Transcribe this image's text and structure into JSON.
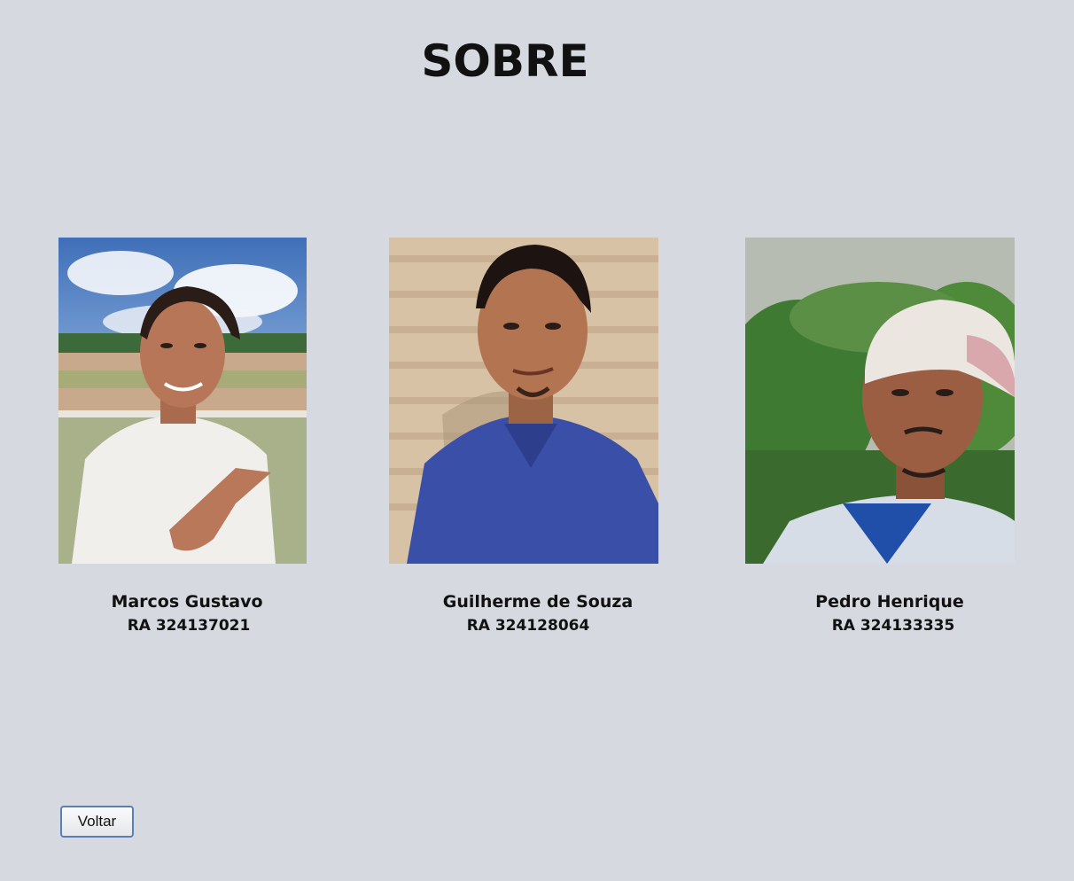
{
  "page": {
    "title": "SOBRE"
  },
  "members": [
    {
      "name": "Marcos Gustavo",
      "ra": "RA 324137021"
    },
    {
      "name": "Guilherme de Souza",
      "ra": "RA 324128064"
    },
    {
      "name": "Pedro Henrique",
      "ra": "RA 324133335"
    }
  ],
  "actions": {
    "back_label": "Voltar"
  },
  "colors": {
    "background": "#d7d9e0",
    "button_border": "#5a7fb3"
  }
}
